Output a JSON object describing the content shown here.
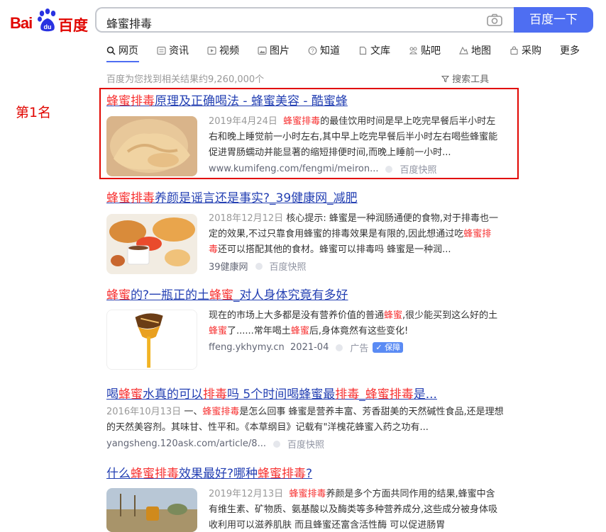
{
  "logo": {
    "text_left": "Bai",
    "text_paw": "du",
    "text_right": "百度"
  },
  "search": {
    "query": "蜂蜜排毒",
    "button": "百度一下"
  },
  "tabs": [
    {
      "label": "网页",
      "icon": "search-icon"
    },
    {
      "label": "资讯",
      "icon": "news-icon"
    },
    {
      "label": "视频",
      "icon": "video-icon"
    },
    {
      "label": "图片",
      "icon": "image-icon"
    },
    {
      "label": "知道",
      "icon": "question-icon"
    },
    {
      "label": "文库",
      "icon": "document-icon"
    },
    {
      "label": "贴吧",
      "icon": "tieba-icon"
    },
    {
      "label": "地图",
      "icon": "map-icon"
    },
    {
      "label": "采购",
      "icon": "shop-icon"
    },
    {
      "label": "更多",
      "icon": ""
    }
  ],
  "result_count": "百度为您找到相关结果约9,260,000个",
  "search_tools": "搜索工具",
  "rank_label": "第1名",
  "results": [
    {
      "title_parts": [
        "蜂蜜排毒",
        "原理及正确喝法 - 蜂蜜美容 - 酷蜜蜂"
      ],
      "date": "2019年4月24日",
      "snippet_parts": [
        "蜂蜜排毒",
        "的最佳饮用时间是早上吃完早餐后半小时左右和晚上睡觉前一小时左右,其中早上吃完早餐后半小时左右喝些蜂蜜能促进胃肠蠕动并能显著的缩短排便时间,而晚上睡前一小时..."
      ],
      "source": "www.kumifeng.com/fengmi/meiron...",
      "cache": "百度快照"
    },
    {
      "title_parts": [
        "蜂蜜排毒",
        "养颜是谣言还是事实?_39健康网_减肥"
      ],
      "date": "2018年12月12日",
      "snippet_parts": [
        "核心提示: 蜂蜜是一种润肠通便的食物,对于排毒也一定的效果,不过只靠食用蜂蜜的排毒效果是有限的,因此想通过吃",
        "蜂蜜排毒",
        "还可以搭配其他的食材。蜂蜜可以排毒吗 蜂蜜是一种润..."
      ],
      "source": "39健康网",
      "cache": "百度快照"
    },
    {
      "title_parts": [
        "蜂蜜",
        "的?一瓶正的土",
        "蜂蜜",
        "_对人身体究竟有多好"
      ],
      "snippet_parts": [
        "现在的市场上大多都是没有营养价值的普通",
        "蜂蜜",
        ",很少能买到这么好的土",
        "蜂蜜",
        "了......常年喝土",
        "蜂蜜",
        "后,身体竟然有这些变化!"
      ],
      "source": "ffeng.ykhymy.cn",
      "date_tail": "2021-04",
      "ad": "广告",
      "badge": "保障"
    },
    {
      "title_parts": [
        "喝",
        "蜂蜜",
        "水真的可以",
        "排毒",
        "吗 5个时间喝蜂蜜最",
        "排毒",
        "_",
        "蜂蜜排毒",
        "是..."
      ],
      "date": "2016年10月13日",
      "snippet_parts": [
        "一、",
        "蜂蜜排毒",
        "是怎么回事 蜂蜜是营养丰富、芳香甜美的天然碱性食品,还是理想的天然美容剂。其味甘、性平和。《本草纲目》记载有\"洋槐花蜂蜜入药之功有..."
      ],
      "source": "yangsheng.120ask.com/article/8...",
      "cache": "百度快照"
    },
    {
      "title_parts": [
        "什么",
        "蜂蜜排毒",
        "效果最好?哪种",
        "蜂蜜排毒",
        "?"
      ],
      "date": "2019年12月13日",
      "snippet_parts": [
        "蜂蜜排毒",
        "养颜是多个方面共同作用的结果,蜂蜜中含有维生素、矿物质、氨基酸以及酶类等多种营养成分,这些成分被身体吸收利用可以滋养肌肤 而且蜂蜜还富含活性酶 可以促进肠胃"
      ]
    }
  ],
  "colors": {
    "accent": "#4e6ef2",
    "highlight": "#f73131",
    "title": "#2440b3",
    "marker": "#e10601"
  }
}
